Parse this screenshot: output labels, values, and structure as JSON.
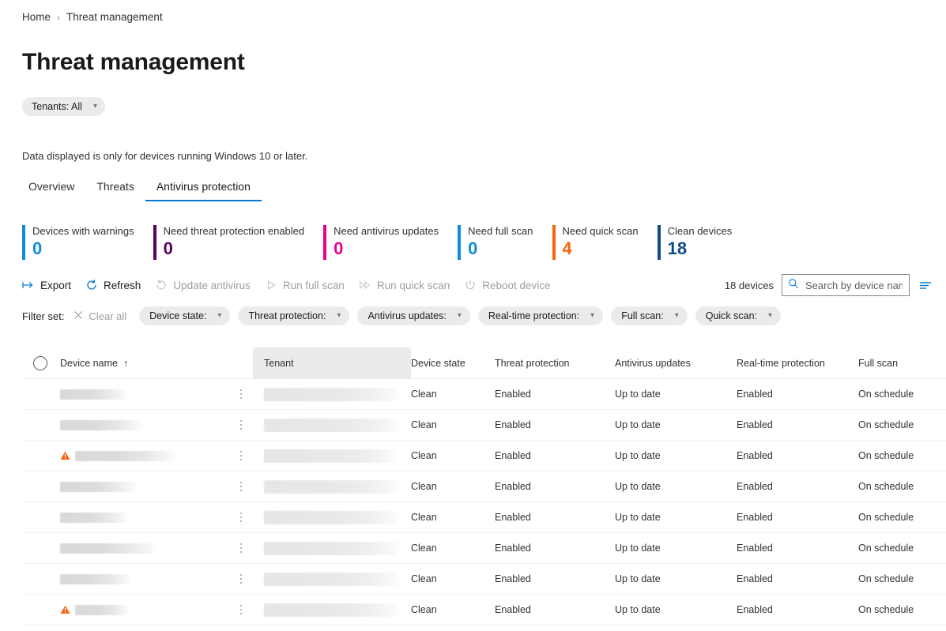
{
  "breadcrumb": {
    "home": "Home",
    "separator": "›",
    "current": "Threat management"
  },
  "page_title": "Threat management",
  "tenant_filter": {
    "label": "Tenants: All"
  },
  "note": "Data displayed is only for devices running Windows 10 or later.",
  "tabs": [
    {
      "label": "Overview",
      "active": false
    },
    {
      "label": "Threats",
      "active": false
    },
    {
      "label": "Antivirus protection",
      "active": true
    }
  ],
  "kpis": [
    {
      "label": "Devices with warnings",
      "value": "0",
      "color": "#0f8bdd"
    },
    {
      "label": "Need threat protection enabled",
      "value": "0",
      "color": "#5c0060"
    },
    {
      "label": "Need antivirus updates",
      "value": "0",
      "color": "#e3008c"
    },
    {
      "label": "Need full scan",
      "value": "0",
      "color": "#0f8bdd"
    },
    {
      "label": "Need quick scan",
      "value": "4",
      "color": "#f7630c"
    },
    {
      "label": "Clean devices",
      "value": "18",
      "color": "#114a8b"
    }
  ],
  "commands": [
    {
      "label": "Export",
      "icon": "export-icon",
      "disabled": false
    },
    {
      "label": "Refresh",
      "icon": "refresh-icon",
      "disabled": false
    },
    {
      "label": "Update antivirus",
      "icon": "update-antivirus-icon",
      "disabled": true
    },
    {
      "label": "Run full scan",
      "icon": "play-icon",
      "disabled": true
    },
    {
      "label": "Run quick scan",
      "icon": "fast-forward-icon",
      "disabled": true
    },
    {
      "label": "Reboot device",
      "icon": "power-icon",
      "disabled": true
    }
  ],
  "device_count": "18 devices",
  "search": {
    "placeholder": "Search by device name",
    "value": ""
  },
  "sort_icon": "filter-sort-icon",
  "filters": {
    "set_label": "Filter set:",
    "clear_all": "Clear all",
    "pills": [
      {
        "label": "Device state:"
      },
      {
        "label": "Threat protection:"
      },
      {
        "label": "Antivirus updates:"
      },
      {
        "label": "Real-time protection:"
      },
      {
        "label": "Full scan:"
      },
      {
        "label": "Quick scan:"
      }
    ]
  },
  "table": {
    "columns": [
      {
        "key": "name",
        "label": "Device name",
        "sort": "↑",
        "highlight": false
      },
      {
        "key": "tenant",
        "label": "Tenant",
        "sort": "",
        "highlight": true
      },
      {
        "key": "state",
        "label": "Device state",
        "sort": "",
        "highlight": false
      },
      {
        "key": "threat",
        "label": "Threat protection",
        "sort": "",
        "highlight": false
      },
      {
        "key": "av",
        "label": "Antivirus updates",
        "sort": "",
        "highlight": false
      },
      {
        "key": "rt",
        "label": "Real-time protection",
        "sort": "",
        "highlight": false
      },
      {
        "key": "full",
        "label": "Full scan",
        "sort": "",
        "highlight": false
      }
    ],
    "rows": [
      {
        "warning": false,
        "name_width": 84,
        "state": "Clean",
        "threat": "Enabled",
        "av": "Up to date",
        "rt": "Enabled",
        "full": "On schedule"
      },
      {
        "warning": false,
        "name_width": 104,
        "state": "Clean",
        "threat": "Enabled",
        "av": "Up to date",
        "rt": "Enabled",
        "full": "On schedule"
      },
      {
        "warning": true,
        "name_width": 127,
        "state": "Clean",
        "threat": "Enabled",
        "av": "Up to date",
        "rt": "Enabled",
        "full": "On schedule"
      },
      {
        "warning": false,
        "name_width": 96,
        "state": "Clean",
        "threat": "Enabled",
        "av": "Up to date",
        "rt": "Enabled",
        "full": "On schedule"
      },
      {
        "warning": false,
        "name_width": 86,
        "state": "Clean",
        "threat": "Enabled",
        "av": "Up to date",
        "rt": "Enabled",
        "full": "On schedule"
      },
      {
        "warning": false,
        "name_width": 122,
        "state": "Clean",
        "threat": "Enabled",
        "av": "Up to date",
        "rt": "Enabled",
        "full": "On schedule"
      },
      {
        "warning": false,
        "name_width": 90,
        "state": "Clean",
        "threat": "Enabled",
        "av": "Up to date",
        "rt": "Enabled",
        "full": "On schedule"
      },
      {
        "warning": true,
        "name_width": 68,
        "state": "Clean",
        "threat": "Enabled",
        "av": "Up to date",
        "rt": "Enabled",
        "full": "On schedule"
      }
    ]
  }
}
